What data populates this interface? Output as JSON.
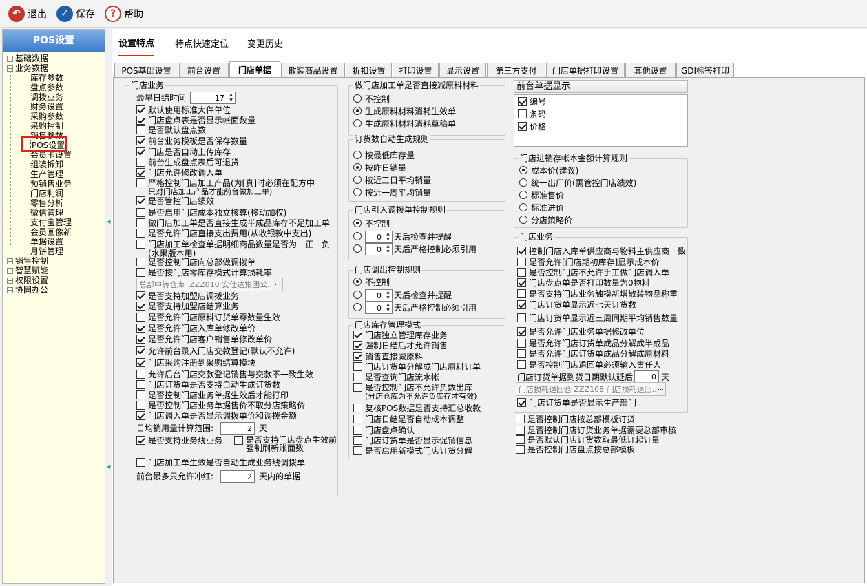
{
  "toolbar": {
    "exit": "退出",
    "save": "保存",
    "help": "帮助"
  },
  "sidebar": {
    "title": "POS设置",
    "groups": [
      "基础数据",
      "业务数据",
      "销售控制",
      "智慧赋能",
      "权限设置",
      "协同办公"
    ],
    "items": [
      "库存参数",
      "盘点参数",
      "调拨业务",
      "财务设置",
      "采购参数",
      "采购控制",
      "销售参数",
      "POS设置",
      "会员卡设置",
      "组装拆卸",
      "生产管理",
      "预销售业务",
      "门店利润",
      "零售分析",
      "微信管理",
      "支付宝管理",
      "会员画像新",
      "单据设置",
      "月饼管理"
    ]
  },
  "top_tabs": [
    "设置特点",
    "特点快速定位",
    "变更历史"
  ],
  "sub_tabs": [
    "POS基础设置",
    "前台设置",
    "门店单据",
    "散装商品设置",
    "折扣设置",
    "打印设置",
    "显示设置",
    "第三方支付",
    "门店单据打印设置",
    "其他设置",
    "GDI标签打印"
  ],
  "store_biz": {
    "title": "门店业务",
    "day_end_label": "最早日结时间",
    "day_end_value": "17",
    "checks": [
      {
        "t": "默认使用标准大件单位",
        "on": true
      },
      {
        "t": "门店盘点表是否显示帐面数量",
        "on": true
      },
      {
        "t": "是否默认盘点数",
        "on": false
      },
      {
        "t": "前台业务模板是否保存数量",
        "on": true
      },
      {
        "t": "门店是否自动上传库存",
        "on": true
      },
      {
        "t": "前台生成盘点表后可退货",
        "on": false
      },
      {
        "t": "门店允许修改调入单",
        "on": true
      },
      {
        "t": "严格控制门店加工产品(为[真]时必须在配方中",
        "on": false
      },
      {
        "t": "是否启用门店成本独立核算(移动加权)",
        "on": false
      },
      {
        "t": "做门店加工单是否直接生成半成品库存不足加工单",
        "on": false
      },
      {
        "t": "是否允许门店直接支出费用(从收银款中支出)",
        "on": false
      },
      {
        "t": "门店加工单检查单据明细商品数量是否为一正一负",
        "on": false
      },
      {
        "t": "是否控制门店向总部做调拨单",
        "on": false
      },
      {
        "t": "是否按门店零库存模式计算损耗率",
        "on": false
      },
      {
        "t": "是否支持加盟店调拨业务",
        "on": true
      },
      {
        "t": "是否支持加盟店结算业务",
        "on": true
      },
      {
        "t": "是否允许门店原料订货单零数量生效",
        "on": false
      },
      {
        "t": "是否允许门店入库单修改单价",
        "on": true
      },
      {
        "t": "是否允许门店客户销售单修改单价",
        "on": true
      },
      {
        "t": "允许前台录入门店交款登记(默认不允许)",
        "on": true
      },
      {
        "t": "门店采购注册到采购结算模块",
        "on": true
      },
      {
        "t": "允许后台门店交款登记销售与交款不一致生效",
        "on": false
      },
      {
        "t": "门店订货单是否支持自动生成订货数",
        "on": false
      },
      {
        "t": "是否控制门店业务单据生效后才能打印",
        "on": false
      },
      {
        "t": "是否控制门店业务单据售价不取分店策略价",
        "on": false
      },
      {
        "t": "门店调入单是否显示调拨单价和调拨金额",
        "on": true
      }
    ],
    "line2_a": "只对门店加工产品才能前台做加工单)",
    "line2_b": "(水果版本用)",
    "perf_check": {
      "t": "是否管控门店绩效",
      "on": true
    },
    "transfer_wh_label": "总部中转仓库",
    "transfer_wh_value": "ZZZ010 安仕达集团公...",
    "avg_range_label": "日均销用量计算范围:",
    "avg_range_value": "2",
    "avg_range_unit": "天",
    "biz_line_check": {
      "t": "是否支持业务线业务",
      "on": true
    },
    "inv_effect_check": {
      "t": "是否支持门店盘点生效前强制刷新账面数",
      "on": false
    },
    "auto_gen_check": {
      "t": "门店加工单生效是否自动生成业务线调拨单",
      "on": false
    },
    "max_days_label": "前台最多只允许冲红:",
    "max_days_value": "2",
    "max_days_unit": "天内的单据"
  },
  "process": {
    "title": "做门店加工单是否直接减原料材料",
    "opts": [
      {
        "t": "不控制",
        "on": false
      },
      {
        "t": "生成原料材料消耗生效单",
        "on": true
      },
      {
        "t": "生成原料材料消耗草稿单",
        "on": false
      }
    ]
  },
  "auto_order": {
    "title": "订货数自动生成规则",
    "opts": [
      {
        "t": "按最低库存量",
        "on": false
      },
      {
        "t": "按昨日销量",
        "on": true
      },
      {
        "t": "按近三日平均销量",
        "on": false
      },
      {
        "t": "按近一周平均销量",
        "on": false
      }
    ]
  },
  "transfer_in": {
    "title": "门店引入调拨单控制规则",
    "none": "不控制",
    "v1": "0",
    "l1": "天后检查并提醒",
    "v2": "0",
    "l2": "天后严格控制必须引用"
  },
  "transfer_out": {
    "title": "门店调出控制规则",
    "none": "不控制",
    "v1": "0",
    "l1": "天后检查并提醒",
    "v2": "0",
    "l2": "天后严格控制必须引用"
  },
  "stock_mode": {
    "title": "门店库存管理模式",
    "checks": [
      {
        "t": "门店独立管理库存业务",
        "on": true
      },
      {
        "t": "强制日结后才允许销售",
        "on": true
      },
      {
        "t": "销售直接减原料",
        "on": true
      },
      {
        "t": "门店订货单分解成门店原料订单",
        "on": false
      },
      {
        "t": "是否查询门店流水帐",
        "on": false
      },
      {
        "t": "是否控制门店不允许负数出库",
        "on": false
      },
      {
        "t": "复核POS数据是否支持汇总收款",
        "on": false
      },
      {
        "t": "门店日结是否自动成本调整",
        "on": false
      },
      {
        "t": "门店盘点确认",
        "on": false
      },
      {
        "t": "门店订货单是否显示促销信息",
        "on": false
      },
      {
        "t": "是否启用新模式门店订货分解",
        "on": false
      }
    ],
    "neg_sub": "(分店仓库为不允许负库存才有效)"
  },
  "receipt_display": {
    "title": "前台单据显示",
    "items": [
      {
        "t": "编号",
        "on": true
      },
      {
        "t": "条码",
        "on": false
      },
      {
        "t": "价格",
        "on": true
      }
    ]
  },
  "cost_rule": {
    "title": "门店进销存帐本金额计算规则",
    "opts": [
      {
        "t": "成本价(建议)",
        "on": true
      },
      {
        "t": "统一出厂价(需管控门店绩效)",
        "on": false
      },
      {
        "t": "标准售价",
        "on": false
      },
      {
        "t": "标准进价",
        "on": false
      },
      {
        "t": "分店策略价",
        "on": false
      }
    ]
  },
  "store_biz2": {
    "title": "门店业务",
    "checks": [
      {
        "t": "控制门店入库单供应商与物料主供应商一致",
        "on": true
      },
      {
        "t": "是否允许[门店期初库存]显示成本价",
        "on": false
      },
      {
        "t": "是否控制门店不允许手工做门店调入单",
        "on": false
      },
      {
        "t": "门店盘点单是否打印数量为0物料",
        "on": true
      },
      {
        "t": "是否支持门店业务触摸新增散装物品称重",
        "on": false
      },
      {
        "t": "门店订货单显示近七天订货数",
        "on": true
      },
      {
        "t": "门店订货单显示近三周同期平均销售数量",
        "on": false
      },
      {
        "t": "是否允许门店业务单据修改单位",
        "on": true
      },
      {
        "t": "是否允许门店订货单成品分解成半成品",
        "on": false
      },
      {
        "t": "是否允许门店订货单成品分解成原材料",
        "on": false
      },
      {
        "t": "是否控制门店退回单必须输入责任人",
        "on": false
      }
    ],
    "delay_label": "门店订货单据到货日期默认延后",
    "delay_value": "0",
    "delay_unit": "天",
    "return_wh": "门店损耗退回仓",
    "return_wh_value": "ZZZ108 门店损耗退回...",
    "show_prod": {
      "t": "门店订货单是否显示生产部门",
      "on": true
    },
    "extra": [
      {
        "t": "是否控制门店按总部模板订货",
        "on": false
      },
      {
        "t": "是否控制门店订货业务单据需要总部审核",
        "on": false
      },
      {
        "t": "是否默认门店订货数取最低订起订量",
        "on": false
      },
      {
        "t": "是否控制门店盘点按总部模板",
        "on": false
      }
    ]
  }
}
